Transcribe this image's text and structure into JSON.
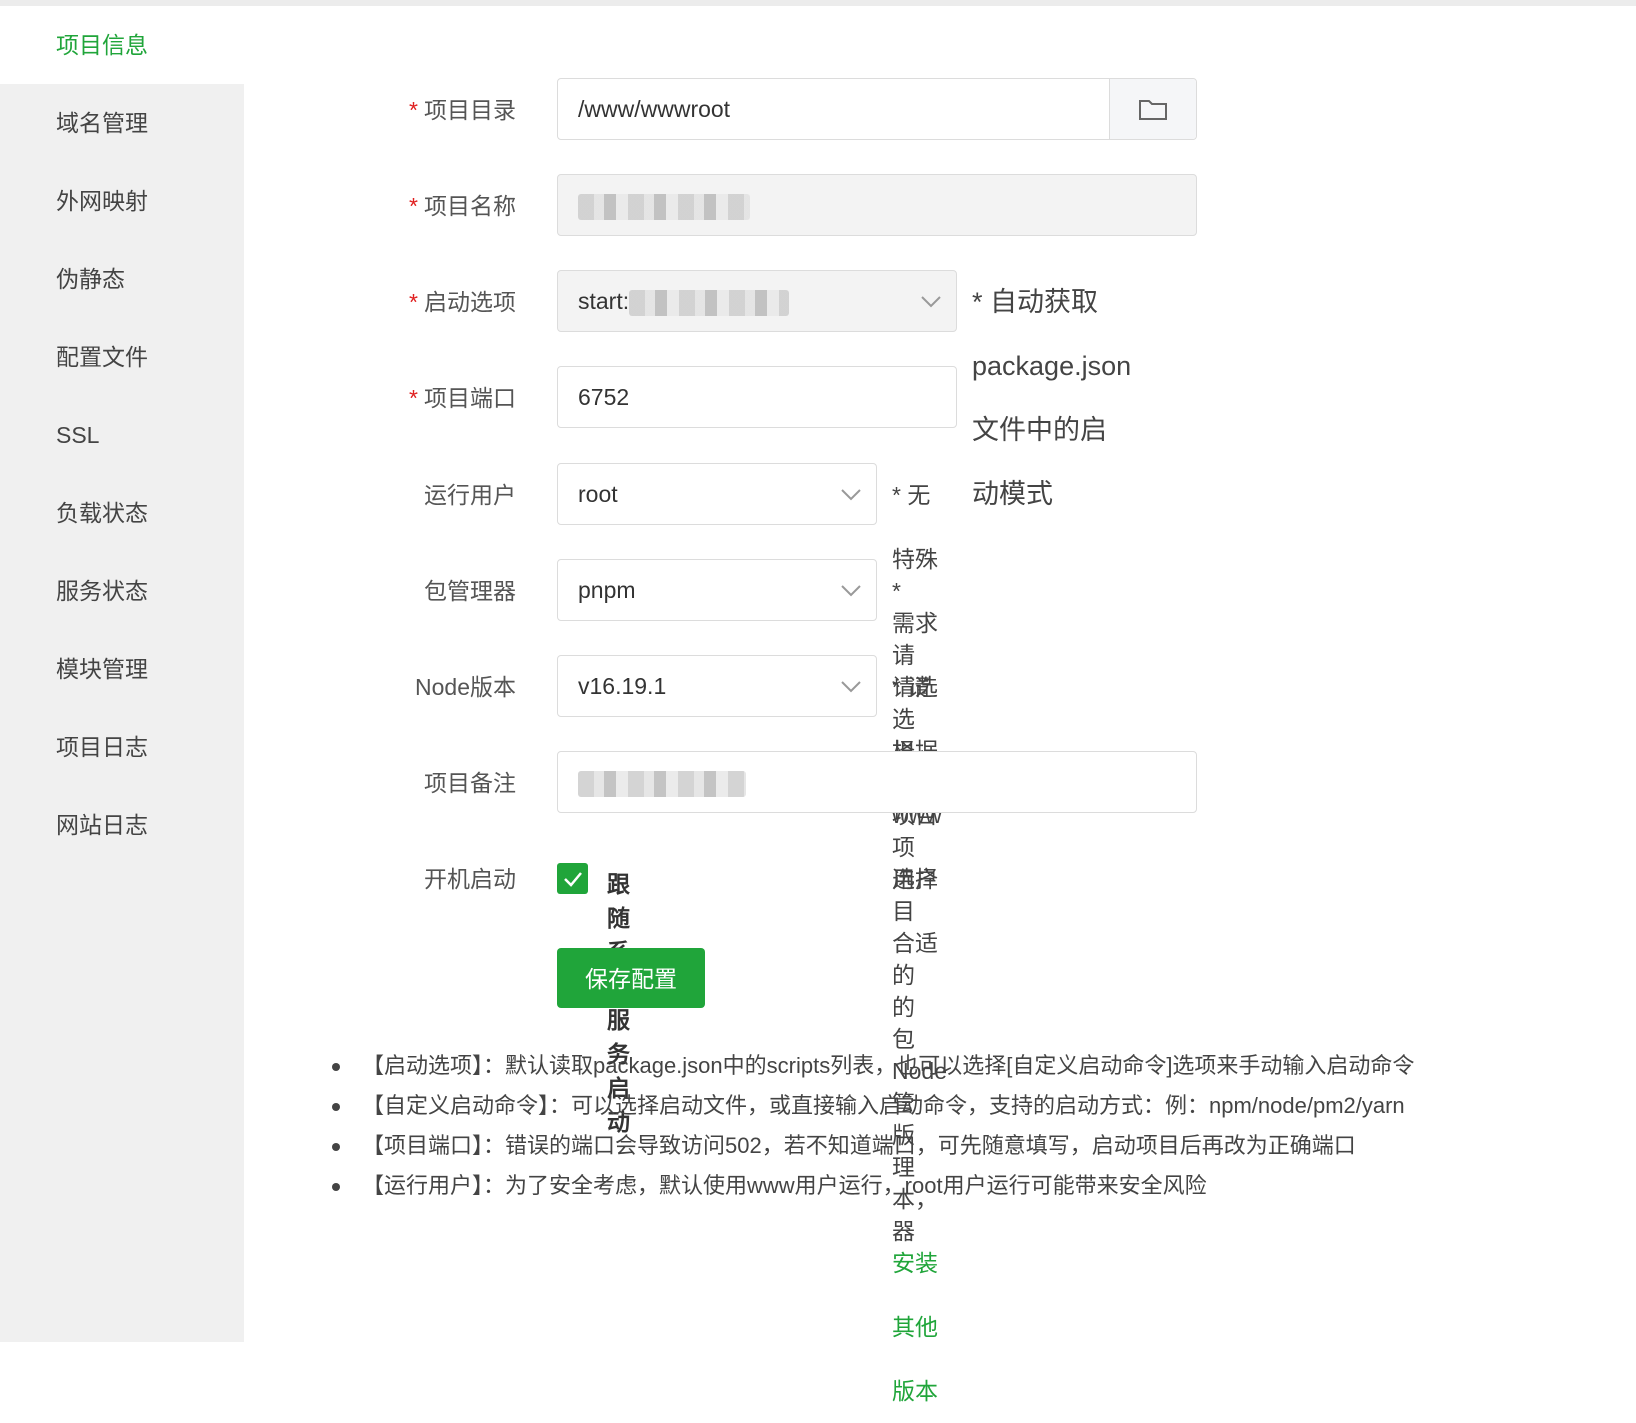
{
  "sidebar": {
    "items": [
      {
        "label": "项目信息",
        "active": true
      },
      {
        "label": "域名管理"
      },
      {
        "label": "外网映射"
      },
      {
        "label": "伪静态"
      },
      {
        "label": "配置文件"
      },
      {
        "label": "SSL"
      },
      {
        "label": "负载状态"
      },
      {
        "label": "服务状态"
      },
      {
        "label": "模块管理"
      },
      {
        "label": "项目日志"
      },
      {
        "label": "网站日志"
      }
    ]
  },
  "form": {
    "required_mark": "*",
    "dir": {
      "label": "项目目录",
      "value": "/www/wwwroot"
    },
    "name": {
      "label": "项目名称"
    },
    "start": {
      "label": "启动选项",
      "value": "start:",
      "hint": "* 自动获取package.json文件中的启动模式"
    },
    "port": {
      "label": "项目端口",
      "value": "6752"
    },
    "user": {
      "label": "运行用户",
      "value": "root",
      "hint": "* 无特殊需求请选择www用户"
    },
    "pkg": {
      "label": "包管理器",
      "value": "pnpm",
      "hint": "* 请选择项目的包管理器"
    },
    "node": {
      "label": "Node版本",
      "value": "v16.19.1",
      "hint": "* 请根据项目选择合适的Node版本，",
      "hint_link": "安装其他版本"
    },
    "remark": {
      "label": "项目备注"
    },
    "boot": {
      "label": "开机启动",
      "checkbox_label": "跟随系统服务启动",
      "checked": true
    },
    "save_label": "保存配置"
  },
  "tips": [
    "【启动选项】：默认读取package.json中的scripts列表，也可以选择[自定义启动命令]选项来手动输入启动命令",
    "【自定义启动命令】：可以选择启动文件，或直接输入启动命令，支持的启动方式：例：npm/node/pm2/yarn",
    "【项目端口】：错误的端口会导致访问502，若不知道端口，可先随意填写，启动项目后再改为正确端口",
    "【运行用户】：为了安全考虑，默认使用www用户运行，root用户运行可能带来安全风险"
  ],
  "colors": {
    "accent": "#20a53a",
    "required": "#e02020"
  }
}
